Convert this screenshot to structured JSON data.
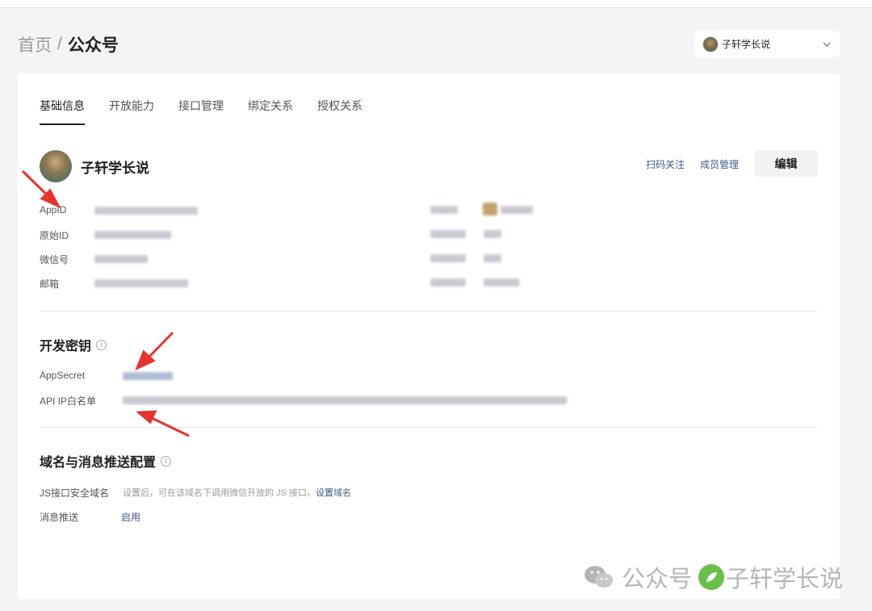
{
  "breadcrumb": {
    "home": "首页",
    "separator": "/",
    "current": "公众号"
  },
  "account_selector": {
    "name": "子轩学长说",
    "icon": "chevron-down-icon"
  },
  "tabs": [
    {
      "label": "基础信息",
      "active": true
    },
    {
      "label": "开放能力",
      "active": false
    },
    {
      "label": "接口管理",
      "active": false
    },
    {
      "label": "绑定关系",
      "active": false
    },
    {
      "label": "授权关系",
      "active": false
    }
  ],
  "profile": {
    "name": "子轩学长说",
    "scan_follow": "扫码关注",
    "member_manage": "成员管理",
    "edit": "编辑"
  },
  "basic_info": {
    "labels": [
      "AppID",
      "原始ID",
      "微信号",
      "邮箱"
    ]
  },
  "dev_key": {
    "title": "开发密钥",
    "info_icon": "i",
    "app_secret_label": "AppSecret",
    "ip_whitelist_label": "API IP白名单"
  },
  "domain_config": {
    "title": "域名与消息推送配置",
    "info_icon": "i",
    "js_domain_label": "JS接口安全域名",
    "js_domain_hint": "设置后，可在该域名下调用微信开放的 JS 接口。",
    "js_domain_link": "设置域名",
    "push_label": "消息推送",
    "push_link": "启用"
  },
  "watermark": {
    "channel": "公众号",
    "author": "子轩学长说"
  },
  "colors": {
    "link": "#3d5a8a",
    "annotation_arrow": "#e8322e",
    "watermark": "#b5b5b5"
  }
}
